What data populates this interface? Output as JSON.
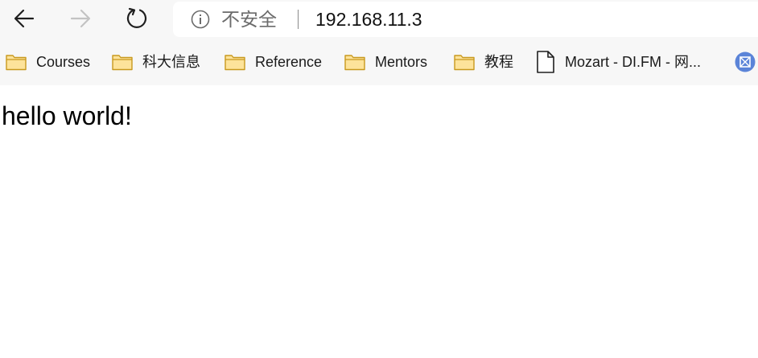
{
  "toolbar": {
    "back_icon": "arrow-left-icon",
    "forward_icon": "arrow-right-icon",
    "reload_icon": "reload-icon"
  },
  "address_bar": {
    "security_icon": "info-icon",
    "security_label": "不安全",
    "url": "192.168.11.3"
  },
  "bookmarks": [
    {
      "icon": "folder-icon",
      "label": "Courses"
    },
    {
      "icon": "folder-icon",
      "label": "科大信息"
    },
    {
      "icon": "folder-icon",
      "label": "Reference"
    },
    {
      "icon": "folder-icon",
      "label": "Mentors"
    },
    {
      "icon": "folder-icon",
      "label": "教程"
    },
    {
      "icon": "page-icon",
      "label": "Mozart - DI.FM - 网..."
    },
    {
      "icon": "image-icon",
      "label": ""
    }
  ],
  "page": {
    "body_text": "hello world!"
  },
  "colors": {
    "toolbar_bg": "#f7f7f7",
    "folder_fill": "#fde39a",
    "folder_stroke": "#c8991e",
    "image_icon_bg": "#5b84d8"
  }
}
